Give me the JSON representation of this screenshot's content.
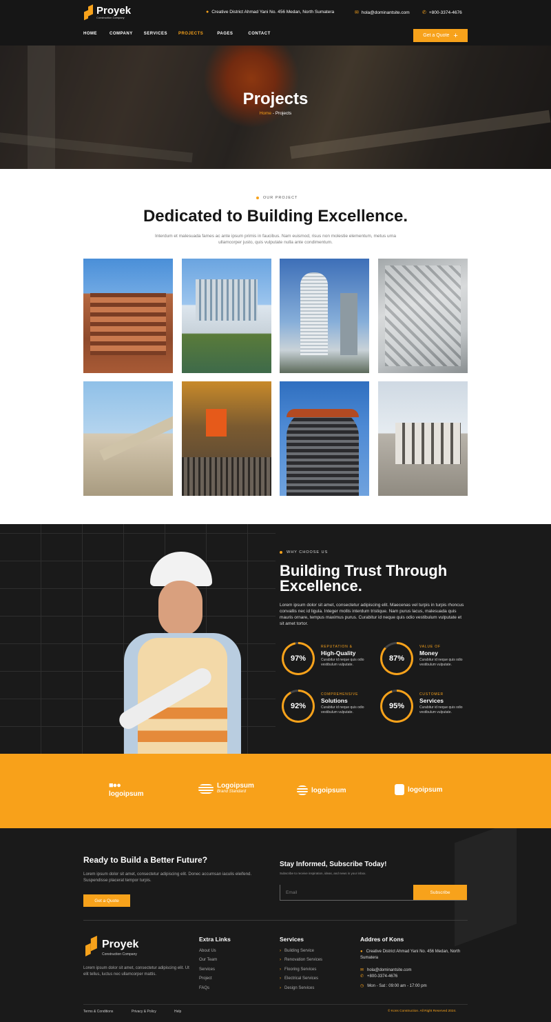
{
  "header": {
    "brand": "Proyek",
    "brand_sub": "Construction Company",
    "address": "Creative District Ahmad Yani No. 456 Medan, North Sumatera",
    "email": "hola@dominantsite.com",
    "phone": "+800-3374-4676",
    "nav": [
      "HOME",
      "COMPANY",
      "SERVICES",
      "PROJECTS",
      "PAGES",
      "CONTACT"
    ],
    "active_nav": "PROJECTS",
    "quote_label": "Get a Quote"
  },
  "hero": {
    "title": "Projects",
    "crumb_home": "Home",
    "crumb_sep": " - ",
    "crumb_current": "Projects"
  },
  "projects": {
    "eyebrow": "OUR PROJECT",
    "title": "Dedicated to Building Excellence.",
    "description": "Interdum et malesuada fames ac ante ipsum primis in faucibus. Nam euismod, risus non molestie elementum, metus urna ullamcorper justo, quis vulputate nulla ante condimentum."
  },
  "why": {
    "eyebrow": "WHY CHOOSE US",
    "title": "Building Trust Through Excellence.",
    "description": "Lorem ipsum dolor sit amet, consectetur adipiscing elit. Maecenas vel turpis in turpis rhoncus convallis nec id ligula. Integer mollis interdum tristique. Nam purus lacus, malesuada quis mauris ornare, tempus maximus purus. Curabitur id neque quis odio vestibulum vulputate et sit amet tortor.",
    "stats": [
      {
        "value": "97%",
        "percent": 97,
        "kicker": "REPUTATION &",
        "title": "High-Quality",
        "desc": "Curabitur id neque quis odio vestibulum vulputate."
      },
      {
        "value": "87%",
        "percent": 87,
        "kicker": "VALUE OF",
        "title": "Money",
        "desc": "Curabitur id neque quis odio vestibulum vulputate."
      },
      {
        "value": "92%",
        "percent": 92,
        "kicker": "COMPREHENSIVE",
        "title": "Solutions",
        "desc": "Curabitur id neque quis odio vestibulum vulputate."
      },
      {
        "value": "95%",
        "percent": 95,
        "kicker": "CUSTOMER",
        "title": "Services",
        "desc": "Curabitur id neque quis odio vestibulum vulputate."
      }
    ]
  },
  "logos": {
    "l1": "logoipsum",
    "l2_main": "Logoipsum",
    "l2_sub": "Brand Standard",
    "l3": "logoipsum",
    "l4": "logoipsum"
  },
  "footer": {
    "cta_title": "Ready to Build a Better Future?",
    "cta_text": "Lorem ipsum dolor sit amet, consectetur adipiscing elit. Donec accumsan iaculis eleifend. Suspendisse placerat tempor turpis.",
    "cta_button": "Get a Quote",
    "subscribe_title": "Stay Informed, Subscribe Today!",
    "subscribe_text": "Subscribe to receive inspiration, ideas, and news in your inbox.",
    "email_placeholder": "Email",
    "subscribe_button": "Subscribe",
    "brand": "Proyek",
    "brand_sub": "Construction Company",
    "about": "Lorem ipsum dolor sit amet, consectetur adipiscing elit. Ut elit tellus, luctus nec ullamcorper mattis.",
    "col_links_title": "Extra Links",
    "links": [
      "About Us",
      "Our Team",
      "Services",
      "Project",
      "FAQs"
    ],
    "col_services_title": "Services",
    "services": [
      "Building Service",
      "Renovation Services",
      "Flooring Services",
      "Electrical Services",
      "Design Services"
    ],
    "col_address_title": "Addres of Kons",
    "address": "Creative District Ahmad Yani No. 456 Medan, North Sumatera",
    "email": "hola@dominantsite.com",
    "phone": "+800-3374-4676",
    "hours": "Mon - Sat : 09:00 am - 17:00 pm",
    "bottom_links": [
      "Terms & Conditions",
      "Privacy & Policy",
      "Help"
    ],
    "copyright": "© Kons Construction. All Right Reserved 2024."
  },
  "colors": {
    "accent": "#f7a21b",
    "dark": "#1a1a1a"
  }
}
